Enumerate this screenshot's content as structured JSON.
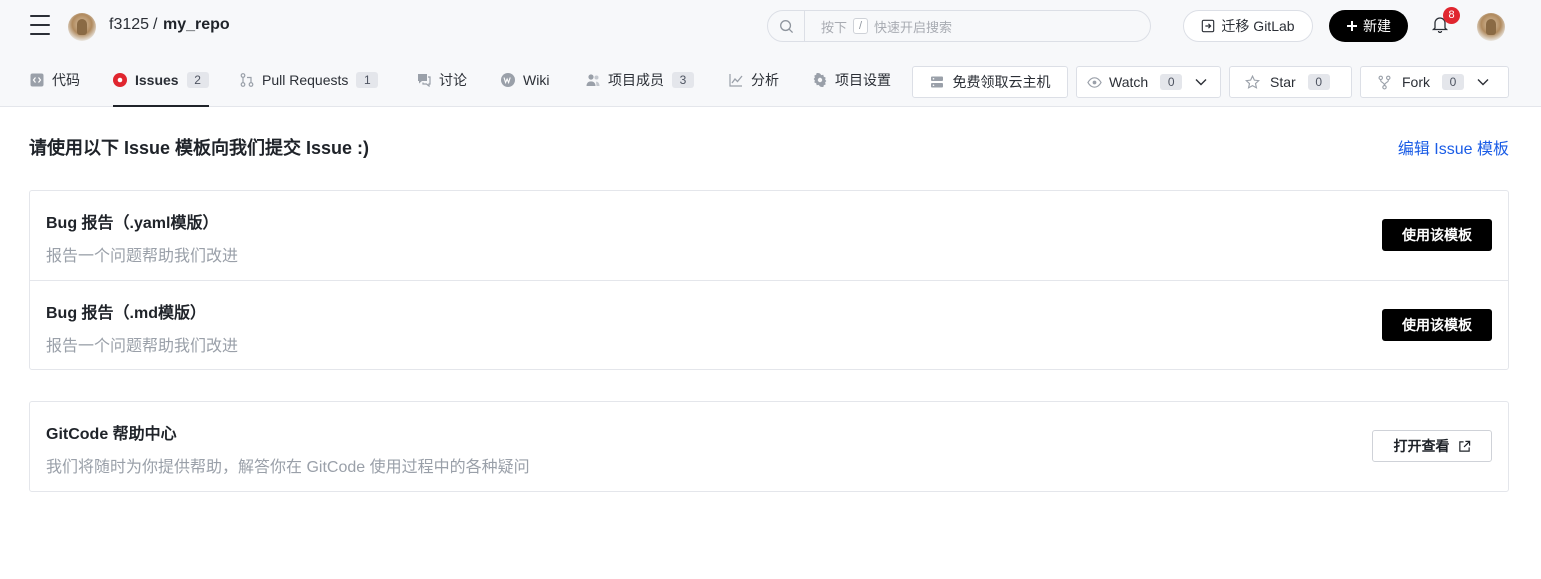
{
  "header": {
    "owner": "f3125",
    "separator": "/",
    "repo": "my_repo",
    "search": {
      "prefix": "按下",
      "key": "/",
      "suffix": "快速开启搜索"
    },
    "migrate_label": "迁移 GitLab",
    "new_label": "新建",
    "notifications": "8"
  },
  "tabs": [
    {
      "label": "代码",
      "icon": "code-icon"
    },
    {
      "label": "Issues",
      "count": "2",
      "icon": "issue-icon",
      "active": true
    },
    {
      "label": "Pull Requests",
      "count": "1",
      "icon": "pull-request-icon"
    },
    {
      "label": "讨论",
      "icon": "discussion-icon"
    },
    {
      "label": "Wiki",
      "icon": "wiki-icon"
    },
    {
      "label": "项目成员",
      "count": "3",
      "icon": "members-icon"
    },
    {
      "label": "分析",
      "icon": "chart-icon"
    },
    {
      "label": "项目设置",
      "icon": "gear-icon"
    }
  ],
  "actions": {
    "cloud_label": "免费领取云主机",
    "watch_label": "Watch",
    "watch_count": "0",
    "star_label": "Star",
    "star_count": "0",
    "fork_label": "Fork",
    "fork_count": "0"
  },
  "main": {
    "heading": "请使用以下 Issue 模板向我们提交 Issue :)",
    "edit_link": "编辑 Issue 模板",
    "templates": [
      {
        "title": "Bug 报告（.yaml模版）",
        "description": "报告一个问题帮助我们改进",
        "button": "使用该模板"
      },
      {
        "title": "Bug 报告（.md模版）",
        "description": "报告一个问题帮助我们改进",
        "button": "使用该模板"
      }
    ],
    "help": {
      "title": "GitCode 帮助中心",
      "description": "我们将随时为你提供帮助，解答你在 GitCode 使用过程中的各种疑问",
      "button": "打开查看"
    }
  },
  "colors": {
    "accent": "#1a5ce6",
    "issue_active": "#e0262f",
    "primary_button": "#000000",
    "badge": "#e0262f"
  }
}
